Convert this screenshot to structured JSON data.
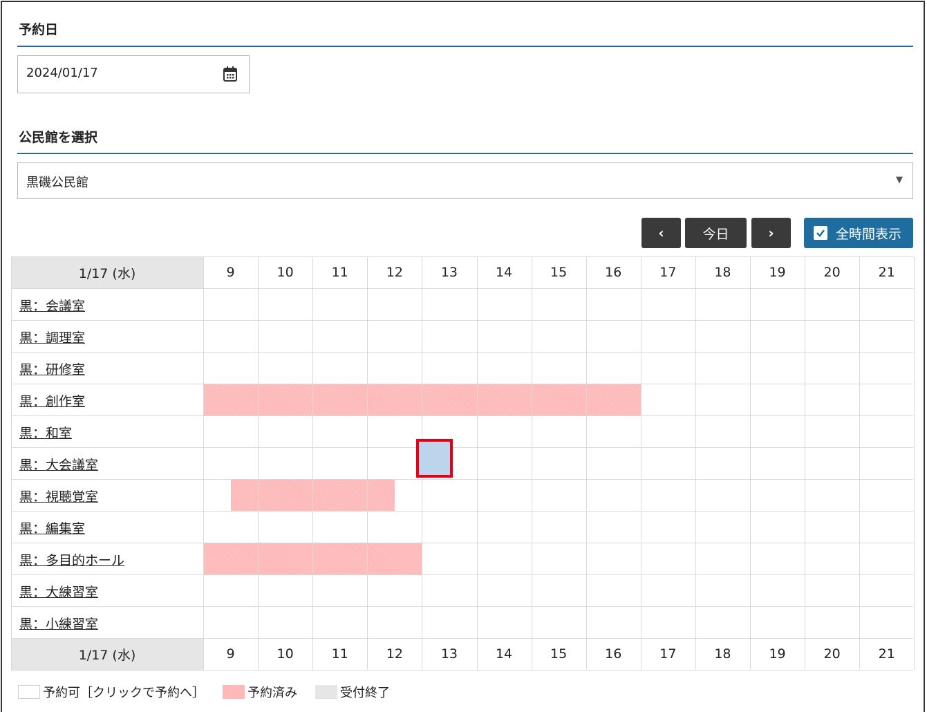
{
  "date_section": {
    "title": "予約日",
    "value": "2024/01/17",
    "icon": "calendar-icon"
  },
  "hall_section": {
    "title": "公民館を選択",
    "value": "黒磯公民館"
  },
  "toolbar": {
    "prev_icon": "chevron-left-icon",
    "today_label": "今日",
    "next_icon": "chevron-right-icon",
    "show_all_label": "全時間表示",
    "show_all_checked": true
  },
  "schedule": {
    "date_label": "1/17 (水)",
    "hours": [
      "9",
      "10",
      "11",
      "12",
      "13",
      "14",
      "15",
      "16",
      "17",
      "18",
      "19",
      "20",
      "21"
    ],
    "rooms": [
      {
        "name": "黒：会議室",
        "booked": []
      },
      {
        "name": "黒：調理室",
        "booked": []
      },
      {
        "name": "黒：研修室",
        "booked": []
      },
      {
        "name": "黒：創作室",
        "booked": [
          [
            9,
            17
          ]
        ]
      },
      {
        "name": "黒：和室",
        "booked": []
      },
      {
        "name": "黒：大会議室",
        "booked": [],
        "selected": [
          13,
          13.5
        ]
      },
      {
        "name": "黒：視聴覚室",
        "booked": [
          [
            9.5,
            12.5
          ]
        ]
      },
      {
        "name": "黒：編集室",
        "booked": []
      },
      {
        "name": "黒：多目的ホール",
        "booked": [
          [
            9,
            13
          ]
        ]
      },
      {
        "name": "黒：大練習室",
        "booked": []
      },
      {
        "name": "黒：小練習室",
        "booked": []
      }
    ]
  },
  "legend": [
    {
      "kind": "free",
      "label": "予約可［クリックで予約へ］"
    },
    {
      "kind": "booked",
      "label": "予約済み"
    },
    {
      "kind": "closed",
      "label": "受付終了"
    }
  ],
  "colors": {
    "booked": "#ffb8b8",
    "closed": "#e6e6e6",
    "selected_fill": "#bcd4ec",
    "selected_border": "#e60012",
    "accent": "#1f6d9f",
    "nav_button": "#3a3a3a"
  }
}
